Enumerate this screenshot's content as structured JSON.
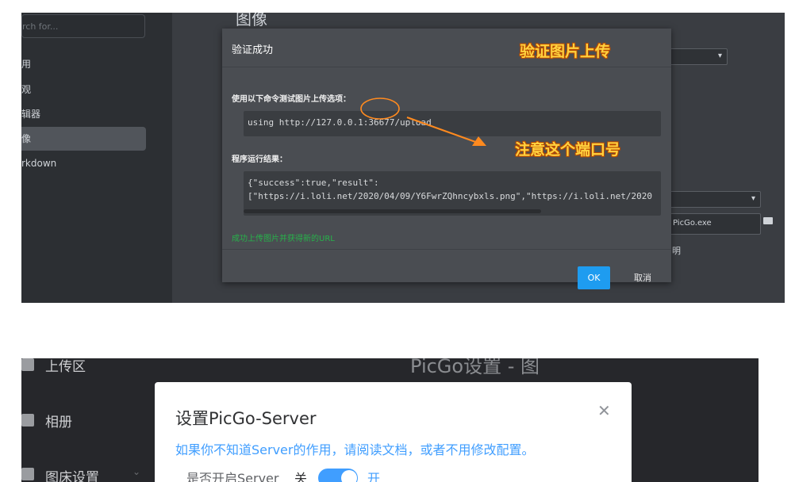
{
  "top": {
    "search_placeholder": "rch for...",
    "sidebar_items": [
      "用",
      "观",
      "辑器",
      "像",
      "rkdown"
    ],
    "bg_title": "图像",
    "bg_path_value": "PicGo.exe",
    "bg_help": "明",
    "dialog": {
      "title": "验证成功",
      "cmd_label": "使用以下命令测试图片上传选项：",
      "cmd": "using http://127.0.0.1:36677/upload",
      "result_label": "程序运行结果：",
      "result_line1": "{\"success\":true,\"result\":",
      "result_line2": "[\"https://i.loli.net/2020/04/09/Y6FwrZQhncybxls.png\",\"https://i.loli.net/2020",
      "success_msg": "成功上传图片并获得新的URL",
      "ok": "OK",
      "cancel": "取消"
    },
    "annotation_title": "验证图片上传",
    "annotation_port": "注意这个端口号",
    "accent_color": "#1e9cf0",
    "annotation_color": "#ff8a1f"
  },
  "bottom": {
    "nav": [
      "上传区",
      "相册",
      "图床设置"
    ],
    "window_title": "PicGo设置 - 图",
    "modal": {
      "title": "设置PicGo-Server",
      "close_icon": "close-icon",
      "link": "如果你不知道Server的作用，请阅读文档，或者不用修改配置。",
      "server_label": "是否开启Server",
      "off": "关",
      "on": "开",
      "switch_on": true
    },
    "accent_color": "#409eff"
  }
}
